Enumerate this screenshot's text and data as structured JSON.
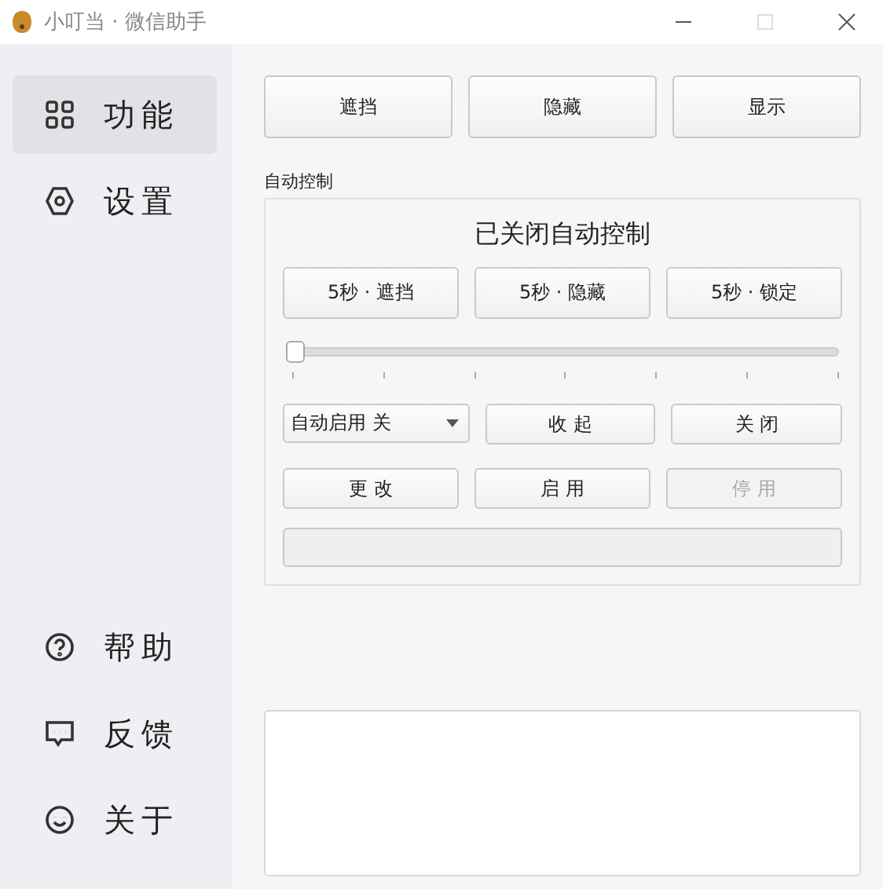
{
  "window": {
    "title": "小叮当 · 微信助手"
  },
  "sidebar": {
    "items": [
      {
        "label": "功能",
        "kind": "grid",
        "selected": true
      },
      {
        "label": "设置",
        "kind": "gear",
        "selected": false
      }
    ],
    "bottom_items": [
      {
        "label": "帮助",
        "kind": "help",
        "selected": false
      },
      {
        "label": "反馈",
        "kind": "chat",
        "selected": false
      },
      {
        "label": "关于",
        "kind": "smile",
        "selected": false
      }
    ]
  },
  "top_buttons": [
    "遮挡",
    "隐藏",
    "显示"
  ],
  "auto_control": {
    "title": "自动控制",
    "status": "已关闭自动控制",
    "timed_buttons": [
      "5秒 · 遮挡",
      "5秒 · 隐藏",
      "5秒 · 锁定"
    ],
    "slider": {
      "level": 0
    },
    "progress": {
      "level": 0
    },
    "dropdown": {
      "value": "自动启用 关"
    },
    "buttons": [
      {
        "label": "收 起",
        "disabled": false
      },
      {
        "label": "关 闭",
        "disabled": false
      },
      {
        "label": "更 改",
        "disabled": false
      },
      {
        "label": "启 用",
        "disabled": false
      },
      {
        "label": "停 用",
        "disabled": true
      }
    ]
  }
}
